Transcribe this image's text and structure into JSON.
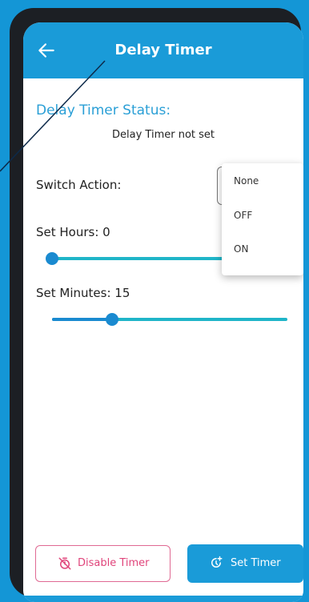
{
  "app_bar": {
    "title": "Delay Timer",
    "back_icon": "arrow-left-icon"
  },
  "status": {
    "label": "Delay Timer Status:",
    "value": "Delay Timer not set"
  },
  "switch_action": {
    "label": "Switch Action:",
    "options": [
      "None",
      "OFF",
      "ON"
    ]
  },
  "hours": {
    "label": "Set Hours: 0",
    "value": 0
  },
  "minutes": {
    "label": "Set Minutes: 15",
    "value": 15
  },
  "buttons": {
    "disable_label": "Disable Timer",
    "disable_icon": "timer-off-icon",
    "set_label": "Set Timer",
    "set_icon": "timer-add-icon"
  },
  "colors": {
    "accent": "#1a9bd8",
    "danger": "#e0457b"
  }
}
